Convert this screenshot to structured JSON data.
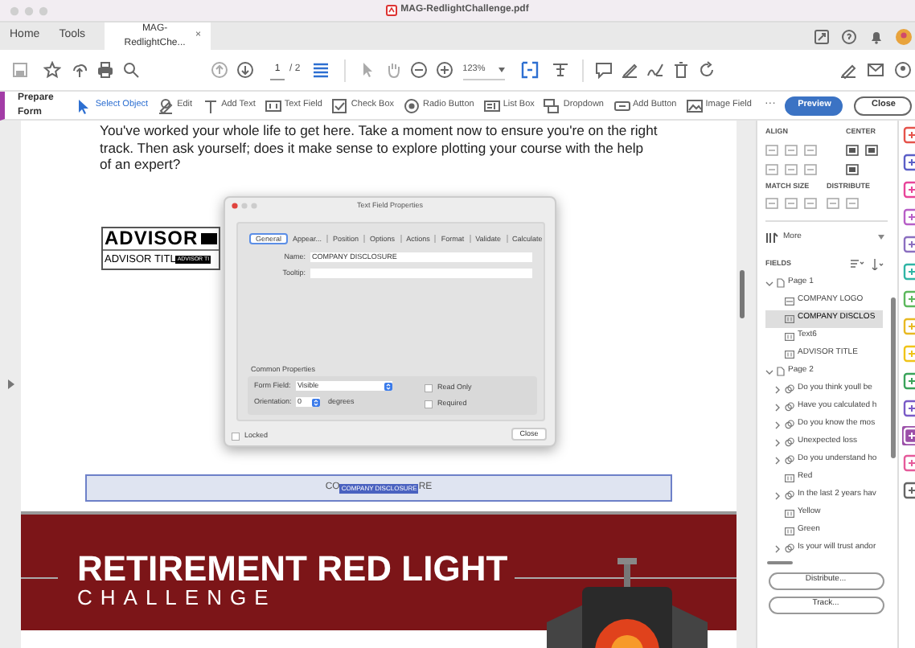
{
  "window": {
    "title": "MAG-RedlightChallenge.pdf"
  },
  "tabs": [
    {
      "label": "Home",
      "selected": false
    },
    {
      "label": "Tools",
      "selected": false
    },
    {
      "label": "MAG-RedlightChe...",
      "selected": true,
      "close": "×"
    }
  ],
  "toolbar": {
    "page_number": "1",
    "page_count": "/ 2",
    "zoom": "123%"
  },
  "prepare_form": {
    "title": "Prepare Form",
    "tools": [
      {
        "label": "Select Object",
        "selected": true
      },
      {
        "label": "Edit",
        "selected": false
      },
      {
        "label": "Add Text",
        "selected": false
      },
      {
        "label": "Text Field",
        "selected": false
      },
      {
        "label": "Check Box",
        "selected": false
      },
      {
        "label": "Radio Button",
        "selected": false
      },
      {
        "label": "List Box",
        "selected": false
      },
      {
        "label": "Dropdown",
        "selected": false
      },
      {
        "label": "Add Button",
        "selected": false
      },
      {
        "label": "Image Field",
        "selected": false
      }
    ],
    "more": "···",
    "buttons": [
      {
        "label": "Preview",
        "kind": "primary"
      },
      {
        "label": "Close",
        "kind": "secondary"
      }
    ]
  },
  "document": {
    "paragraph": [
      "You've worked your whole life to get here. Take a moment now to ensure you're on the right",
      "track. Then ask yourself; does it make sense to explore plotting your course with the help",
      "of an expert?"
    ],
    "advisor_name": {
      "text": "ADVISOR"
    },
    "advisor_title": {
      "text": "ADVISOR TITL",
      "badge": "ADVISOR TI"
    },
    "selected_field": {
      "text_before": "CO",
      "badge": "COMPANY DISCLOSURE",
      "text_after": "RE"
    },
    "banner": {
      "title": "RETIREMENT RED LIGHT",
      "subtitle": "CHALLENGE"
    }
  },
  "dialog": {
    "title": "Text Field Properties",
    "tabs": [
      {
        "label": "General",
        "selected": true
      },
      {
        "label": "Appear...",
        "selected": false
      },
      {
        "label": "Position",
        "selected": false
      },
      {
        "label": "Options",
        "selected": false
      },
      {
        "label": "Actions",
        "selected": false
      },
      {
        "label": "Format",
        "selected": false
      },
      {
        "label": "Validate",
        "selected": false
      },
      {
        "label": "Calculate",
        "selected": false
      }
    ],
    "fields": [
      {
        "label": "Name:",
        "value": "COMPANY DISCLOSURE"
      },
      {
        "label": "Tooltip:"
      }
    ],
    "common_properties": {
      "title": "Common Properties",
      "form_field": {
        "label": "Form Field:",
        "value": "Visible"
      },
      "orientation": {
        "label": "Orientation:",
        "value": "0",
        "unit": "degrees"
      },
      "checkboxes": [
        {
          "label": "Read Only",
          "checked": false
        },
        {
          "label": "Required",
          "checked": false
        }
      ]
    },
    "locked": {
      "label": "Locked",
      "checked": false
    },
    "close": "Close"
  },
  "side_panel": {
    "align": "ALIGN",
    "center": "CENTER",
    "match_size": "MATCH SIZE",
    "distribute": "DISTRIBUTE",
    "more": "More",
    "fields_title": "FIELDS",
    "tree": [
      {
        "label": "Page 1",
        "kind": "page",
        "expanded": true,
        "selected": false,
        "children": [
          {
            "label": "COMPANY LOGO",
            "kind": "image",
            "selected": false
          },
          {
            "label": "COMPANY DISCLOS",
            "kind": "text",
            "selected": true
          },
          {
            "label": "Text6",
            "kind": "text",
            "selected": false
          },
          {
            "label": "ADVISOR TITLE",
            "kind": "text",
            "selected": false
          }
        ]
      },
      {
        "label": "Page 2",
        "kind": "page",
        "expanded": true,
        "selected": false,
        "children": [
          {
            "label": "Do you think youll be",
            "kind": "group",
            "expanded": false,
            "selected": false
          },
          {
            "label": "Have you calculated h",
            "kind": "group",
            "expanded": false,
            "selected": false
          },
          {
            "label": "Do you know the mos",
            "kind": "group",
            "expanded": false,
            "selected": false
          },
          {
            "label": "Unexpected loss",
            "kind": "group",
            "expanded": false,
            "selected": false
          },
          {
            "label": "Do you understand ho",
            "kind": "group",
            "expanded": false,
            "selected": false
          },
          {
            "label": "Red",
            "kind": "text",
            "selected": false
          },
          {
            "label": "In the last 2 years hav",
            "kind": "group",
            "expanded": false,
            "selected": false
          },
          {
            "label": "Yellow",
            "kind": "text",
            "selected": false
          },
          {
            "label": "Green",
            "kind": "text",
            "selected": false
          },
          {
            "label": "Is your will trust andor",
            "kind": "group",
            "expanded": false,
            "selected": false
          }
        ]
      }
    ],
    "buttons": [
      "Distribute...",
      "Track..."
    ]
  },
  "tool_strip": [
    {
      "color": "#e5534b",
      "selected": false
    },
    {
      "color": "#5b5fc7",
      "selected": false
    },
    {
      "color": "#e8459a",
      "selected": false
    },
    {
      "color": "#b75fc7",
      "selected": false
    },
    {
      "color": "#8b6fc0",
      "selected": false
    },
    {
      "color": "#2fb5a5",
      "selected": false
    },
    {
      "color": "#5cb85c",
      "selected": false
    },
    {
      "color": "#e8b923",
      "selected": false
    },
    {
      "color": "#f0c419",
      "selected": false
    },
    {
      "color": "#3aa35a",
      "selected": false
    },
    {
      "color": "#7a5bc7",
      "selected": false
    },
    {
      "color": "#9b4fa8",
      "selected": true
    },
    {
      "color": "#e55a9a",
      "selected": false
    },
    {
      "color": "#666666",
      "selected": false
    }
  ]
}
